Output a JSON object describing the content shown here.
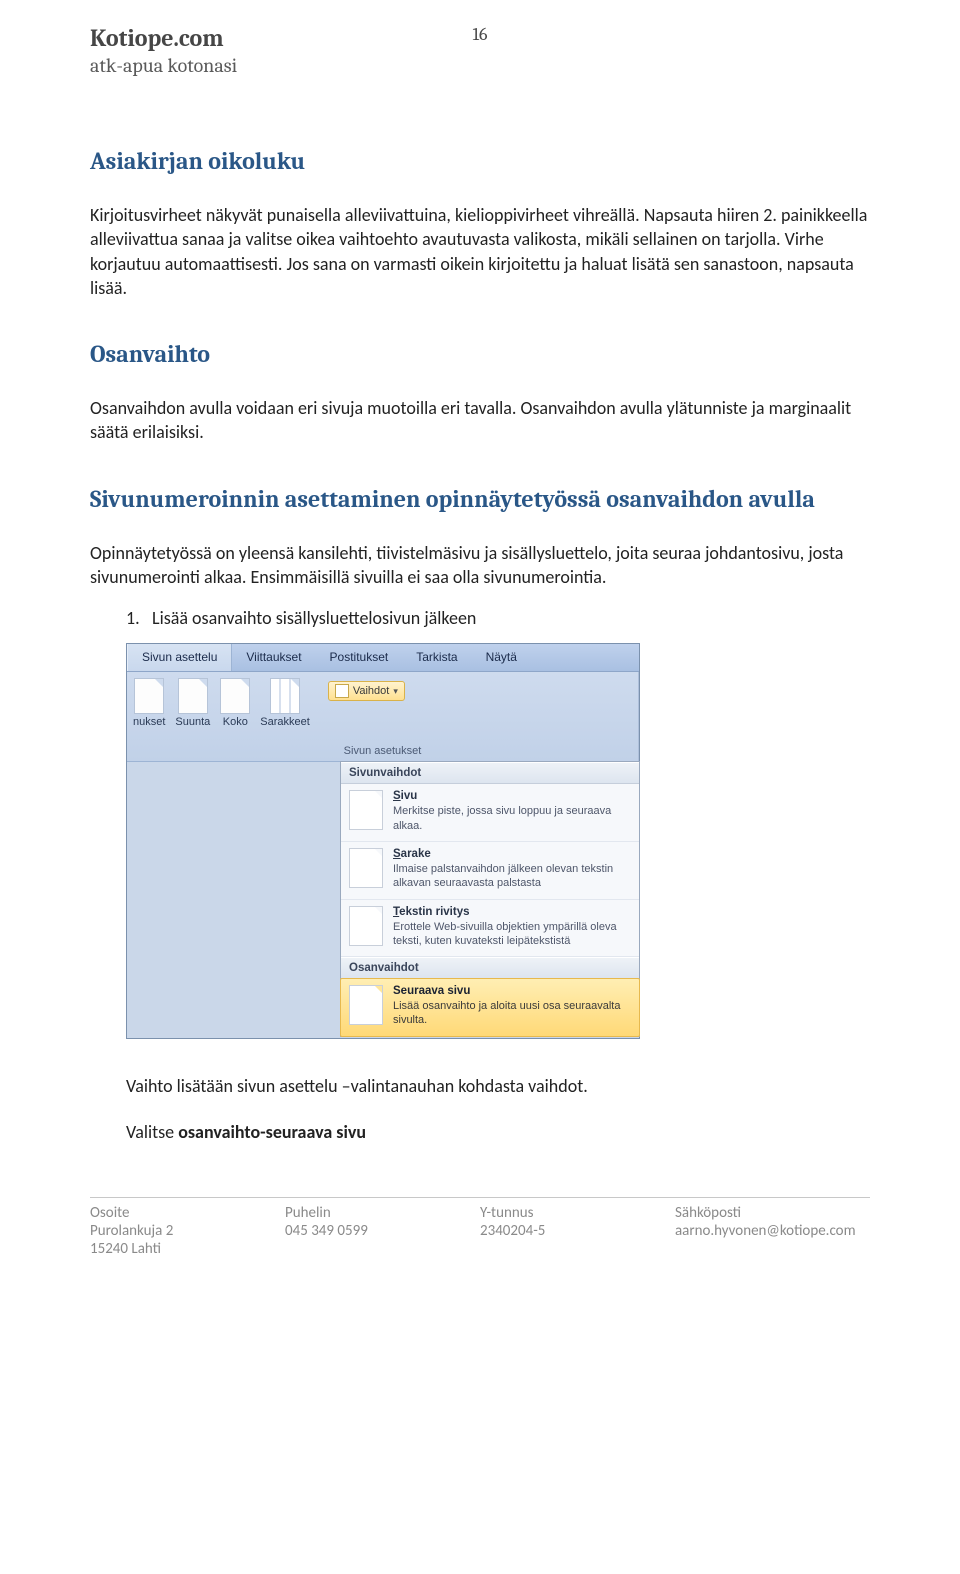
{
  "header": {
    "site": "Kotiope.com",
    "tagline": "atk-apua kotonasi",
    "page_number": "16"
  },
  "section1": {
    "title": "Asiakirjan oikoluku",
    "p1_a": "Kirjoitusvirheet näkyvät punaisella alleviivattuina, kielioppivirheet vihreällä. Napsauta hiiren 2. painikkeella alleviivattua sanaa ja valitse oikea vaihtoehto avautuvasta valikosta, mikäli sellainen on tarjolla. Virhe korjautuu automaattisesti. Jos sana on varmasti oikein kirjoitettu ja haluat lisätä sen sanastoon, napsauta lisää."
  },
  "section2": {
    "title": "Osanvaihto",
    "p1": "Osanvaihdon avulla voidaan eri sivuja muotoilla eri tavalla.   Osanvaihdon avulla ylätunniste ja marginaalit säätä erilaisiksi."
  },
  "section3": {
    "title": "Sivunumeroinnin asettaminen opinnäytetyössä osanvaihdon avulla",
    "p1": "Opinnäytetyössä on yleensä kansilehti, tiivistelmäsivu ja sisällysluettelo, joita seuraa johdantosivu, josta sivunumerointi alkaa. Ensimmäisillä sivuilla ei saa olla sivunumerointia.",
    "list_item": "Lisää osanvaihto sisällysluettelosivun jälkeen",
    "after1": "Vaihto lisätään sivun asettelu –valintanauhan kohdasta vaihdot.",
    "after2_a": "Valitse ",
    "after2_b": "osanvaihto-seuraava sivu"
  },
  "ribbon": {
    "tabs": [
      "Sivun asettelu",
      "Viittaukset",
      "Postitukset",
      "Tarkista",
      "Näytä"
    ],
    "group1_icons": [
      "nukset",
      "Suunta",
      "Koko",
      "Sarakkeet"
    ],
    "group1_label": "Sivun asetukset",
    "vaihdot_label": "Vaihdot"
  },
  "dropdown": {
    "header1": "Sivunvaihdot",
    "items1": [
      {
        "title": "Sivu",
        "u": "S",
        "desc": "Merkitse piste, jossa sivu loppuu ja seuraava alkaa."
      },
      {
        "title": "Sarake",
        "u": "S",
        "desc": "Ilmaise palstanvaihdon jälkeen olevan tekstin alkavan seuraavasta palstasta"
      },
      {
        "title": "Tekstin rivitys",
        "u": "T",
        "desc": "Erottele Web-sivuilla objektien ympärillä oleva teksti, kuten kuvateksti leipätekstistä"
      }
    ],
    "header2": "Osanvaihdot",
    "items2": [
      {
        "title": "Seuraava sivu",
        "u": "",
        "desc": "Lisää osanvaihto ja aloita uusi osa seuraavalta sivulta."
      }
    ]
  },
  "footer": {
    "cols": [
      {
        "hdr": "Osoite",
        "v1": "Purolankuja 2",
        "v2": "15240 Lahti"
      },
      {
        "hdr": "Puhelin",
        "v1": "045 349 0599",
        "v2": ""
      },
      {
        "hdr": "Y-tunnus",
        "v1": "2340204-5",
        "v2": ""
      },
      {
        "hdr": "Sähköposti",
        "v1": "aarno.hyvonen@kotiope.com",
        "v2": ""
      }
    ]
  }
}
